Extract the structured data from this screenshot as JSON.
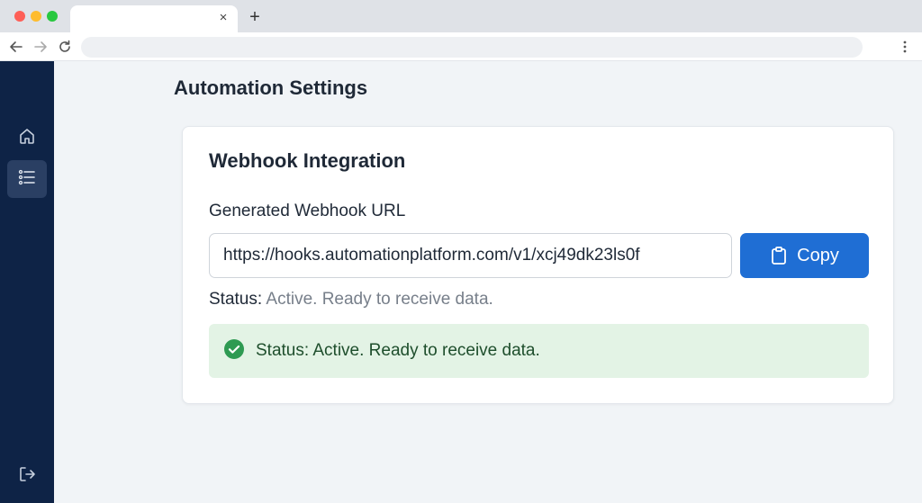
{
  "browser": {
    "tab_close_glyph": "×",
    "new_tab_glyph": "+",
    "icons": [
      "back-arrow-icon",
      "forward-arrow-icon",
      "reload-icon",
      "more-vertical-icon"
    ]
  },
  "sidebar": {
    "items": [
      {
        "name": "home",
        "icon": "home-icon",
        "active": false
      },
      {
        "name": "list",
        "icon": "list-icon",
        "active": true
      },
      {
        "name": "logout",
        "icon": "logout-icon",
        "active": false
      }
    ]
  },
  "page": {
    "title": "Automation Settings"
  },
  "card": {
    "title": "Webhook Integration",
    "field_label": "Generated Webhook URL",
    "url_value": "https://hooks.automationplatform.com/v1/xcj49dk23ls0f",
    "copy_label": "Copy",
    "copy_icon": "clipboard-icon",
    "status_key": "Status:",
    "status_text": "Active. Ready to receive data.",
    "alert_text": "Status: Active. Ready to receive data.",
    "alert_icon": "check-circle-icon"
  },
  "colors": {
    "sidebar_bg": "#0e2346",
    "sidebar_active_bg": "#2a3f63",
    "accent": "#1f6ed4",
    "success_bg": "#e3f3e5",
    "success_icon": "#2e9a52",
    "success_text": "#1e4e2c"
  }
}
